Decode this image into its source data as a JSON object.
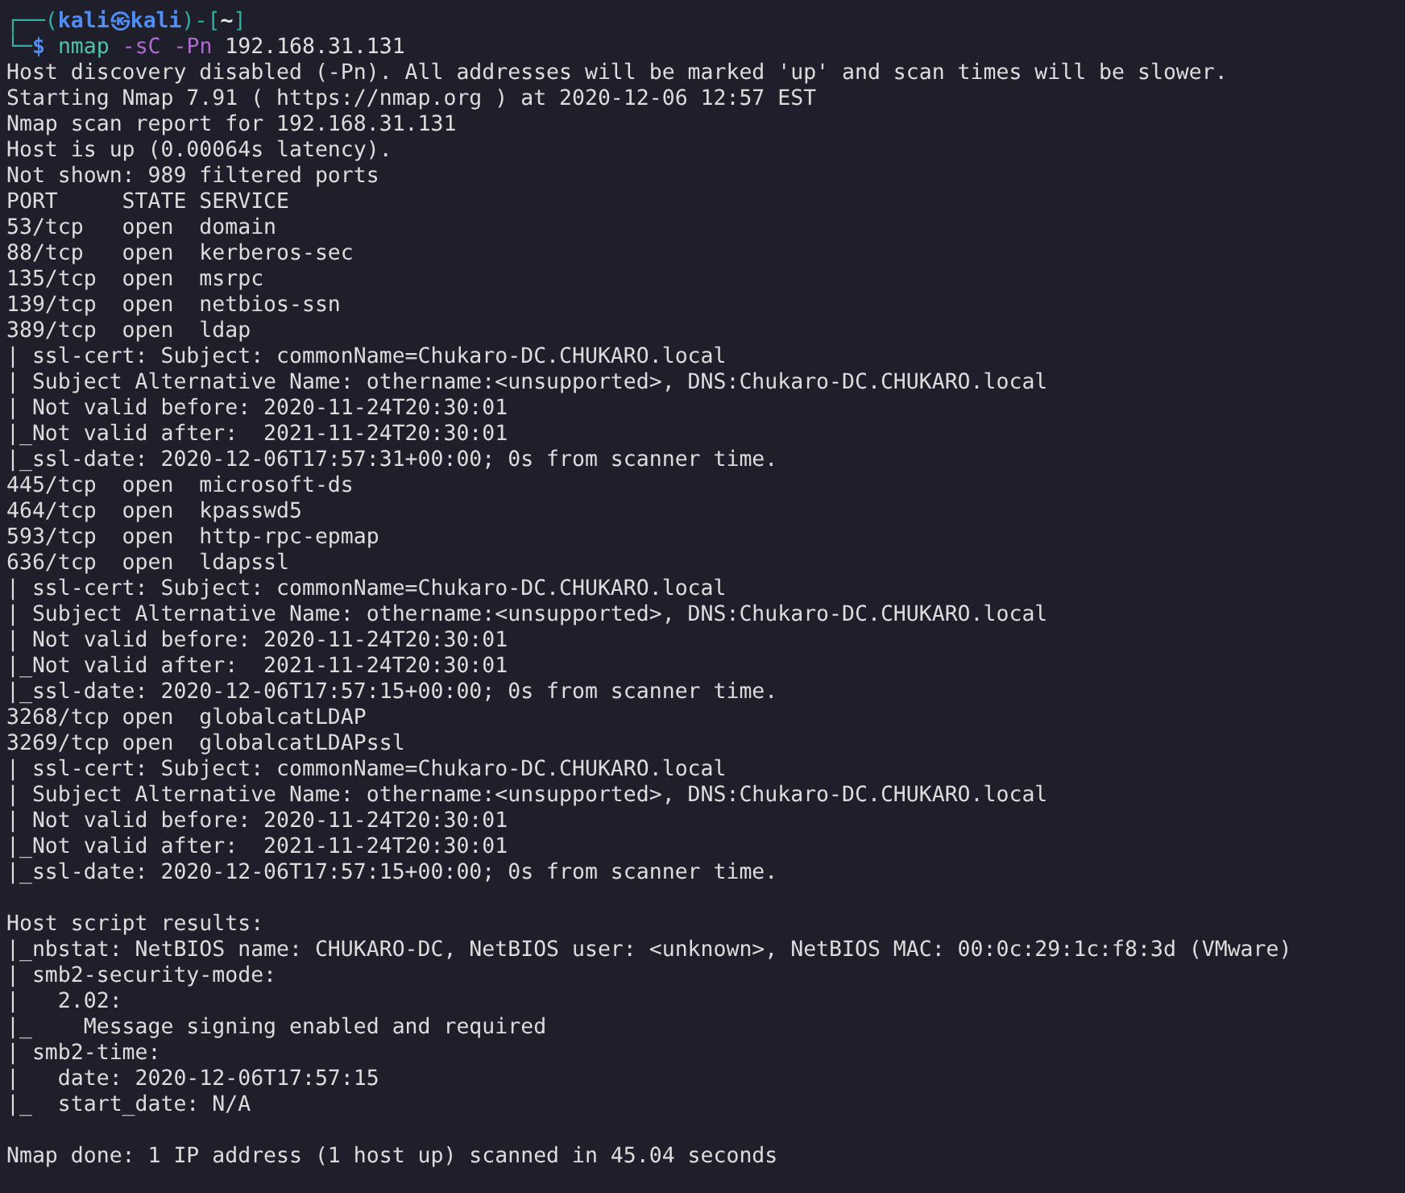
{
  "prompt": {
    "frame_open": "┌──(",
    "user": "kali",
    "at": "㉿",
    "host": "kali",
    "frame_mid": ")-[",
    "cwd": "~",
    "frame_close": "]",
    "frame_corner": "└─",
    "symbol": "$"
  },
  "command": {
    "program": "nmap",
    "options": "-sC -Pn",
    "target": "192.168.31.131"
  },
  "output_blocks": [
    [
      "Host discovery disabled (-Pn). All addresses will be marked 'up' and scan times will be slower.",
      "Starting Nmap 7.91 ( https://nmap.org ) at 2020-12-06 12:57 EST",
      "Nmap scan report for 192.168.31.131",
      "Host is up (0.00064s latency).",
      "Not shown: 989 filtered ports",
      "PORT     STATE SERVICE",
      "53/tcp   open  domain",
      "88/tcp   open  kerberos-sec",
      "135/tcp  open  msrpc",
      "139/tcp  open  netbios-ssn",
      "389/tcp  open  ldap",
      "| ssl-cert: Subject: commonName=Chukaro-DC.CHUKARO.local",
      "| Subject Alternative Name: othername:<unsupported>, DNS:Chukaro-DC.CHUKARO.local",
      "| Not valid before: 2020-11-24T20:30:01",
      "|_Not valid after:  2021-11-24T20:30:01",
      "|_ssl-date: 2020-12-06T17:57:31+00:00; 0s from scanner time.",
      "445/tcp  open  microsoft-ds",
      "464/tcp  open  kpasswd5",
      "593/tcp  open  http-rpc-epmap",
      "636/tcp  open  ldapssl",
      "| ssl-cert: Subject: commonName=Chukaro-DC.CHUKARO.local",
      "| Subject Alternative Name: othername:<unsupported>, DNS:Chukaro-DC.CHUKARO.local",
      "| Not valid before: 2020-11-24T20:30:01",
      "|_Not valid after:  2021-11-24T20:30:01",
      "|_ssl-date: 2020-12-06T17:57:15+00:00; 0s from scanner time.",
      "3268/tcp open  globalcatLDAP",
      "3269/tcp open  globalcatLDAPssl",
      "| ssl-cert: Subject: commonName=Chukaro-DC.CHUKARO.local",
      "| Subject Alternative Name: othername:<unsupported>, DNS:Chukaro-DC.CHUKARO.local",
      "| Not valid before: 2020-11-24T20:30:01",
      "|_Not valid after:  2021-11-24T20:30:01",
      "|_ssl-date: 2020-12-06T17:57:15+00:00; 0s from scanner time."
    ],
    [
      "Host script results:",
      "|_nbstat: NetBIOS name: CHUKARO-DC, NetBIOS user: <unknown>, NetBIOS MAC: 00:0c:29:1c:f8:3d (VMware)",
      "| smb2-security-mode: ",
      "|   2.02: ",
      "|_    Message signing enabled and required",
      "| smb2-time: ",
      "|   date: 2020-12-06T17:57:15",
      "|_  start_date: N/A"
    ],
    [
      "Nmap done: 1 IP address (1 host up) scanned in 45.04 seconds"
    ]
  ]
}
